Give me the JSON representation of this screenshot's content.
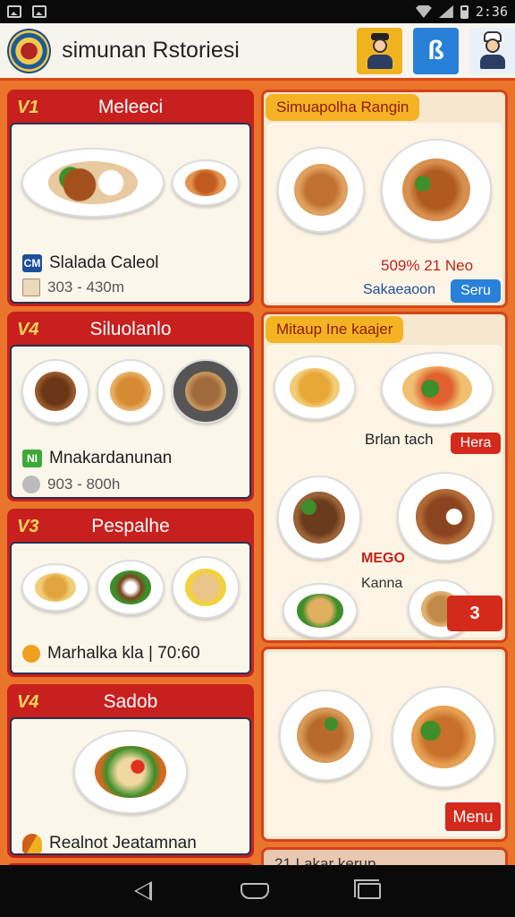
{
  "status_bar": {
    "time": "2:36"
  },
  "header": {
    "title": "simunan Rstoriesi"
  },
  "left_cards": [
    {
      "tag": "V1",
      "title": "Meleeci",
      "info_badge": "CM",
      "info_text": "Slalada Caleol",
      "sub_text": "303 - 430m"
    },
    {
      "tag": "V4",
      "title": "Siluolanlo",
      "info_badge": "NI",
      "info_text": "Mnakardanunan",
      "sub_text": "903 - 800h"
    },
    {
      "tag": "V3",
      "title": "Pespalhe",
      "info_text": "Marhalka kla | 70:60"
    },
    {
      "tag": "V4",
      "title": "Sadob",
      "info_text": "Realnot Jeatamnan"
    }
  ],
  "right_cards": [
    {
      "title": "Simuapolha Rangin",
      "price_text": "509% 21 Neo",
      "label_text": "Sakaeaoon",
      "button": "Seru"
    },
    {
      "title": "Mitaup Ine kaajer",
      "red_text": "Brlan tach",
      "button": "Hera",
      "side_label_1": "MEGO",
      "side_label_2": "Kanna",
      "badge": "3"
    },
    {
      "button": "Menu"
    },
    {
      "title": "21 Lakar kerup"
    }
  ],
  "colors": {
    "brand_red": "#c8201e",
    "accent_orange": "#e9742a",
    "accent_yellow": "#f5b324",
    "button_blue": "#2880d8",
    "cream": "#fbf6ea"
  }
}
